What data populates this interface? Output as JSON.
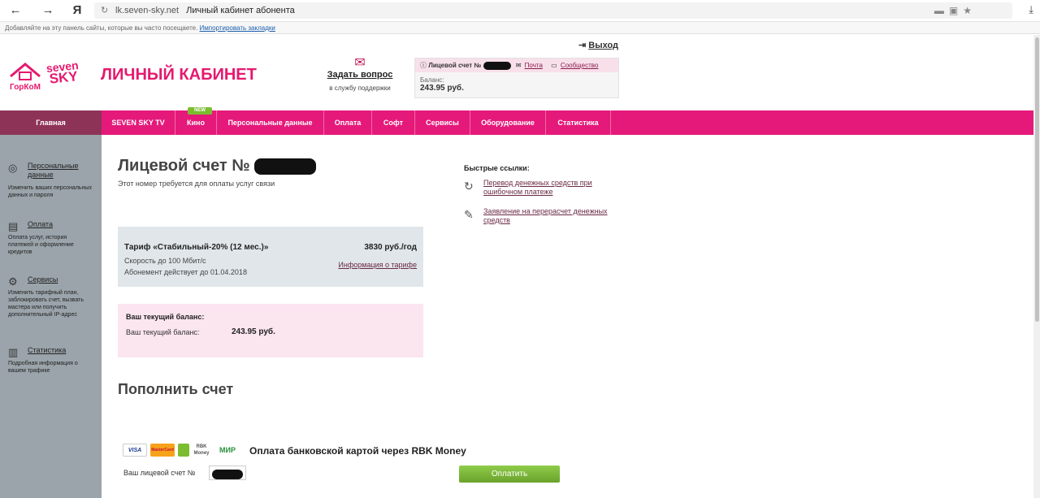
{
  "browser": {
    "nav_back": "←",
    "nav_forward": "→",
    "yandex_icon": "Я",
    "domain": "lk.seven-sky.net",
    "page_title": "Личный кабинет абонента",
    "bookmarks_prompt": "Добавляйте на эту панель сайты, которые вы часто посещаете.",
    "bookmarks_link": "Импортировать закладки"
  },
  "header": {
    "logo_gorkom": "ГорКоМ",
    "logo_seven": "seven",
    "logo_sky": "SKY",
    "title": "ЛИЧНЫЙ КАБИНЕТ",
    "ask_title": "Задать вопрос",
    "ask_sub": "в службу поддержки",
    "logout": "Выход",
    "account_label": "Лицевой счет №",
    "mail_link": "Почта",
    "community_link": "Сообщество",
    "balance_label": "Баланс:",
    "balance_value": "243.95 руб."
  },
  "nav": {
    "home": "Главная",
    "items": [
      "SEVEN SKY TV",
      "Кино",
      "Персональные данные",
      "Оплата",
      "Софт",
      "Сервисы",
      "Оборудование",
      "Статистика"
    ],
    "new_badge": "NEW"
  },
  "sidebar": {
    "items": [
      {
        "label": "Персональные данные",
        "desc": "Изменить ваших персональных данных и пароля",
        "icon": "person-icon"
      },
      {
        "label": "Оплата",
        "desc": "Оплата услуг, история платежей и оформление кредитов",
        "icon": "wallet-icon"
      },
      {
        "label": "Сервисы",
        "desc": "Изменить тарифный план, заблокировать счет, вызвать мастера или получить дополнительный IP-адрес",
        "icon": "gear-icon"
      },
      {
        "label": "Статистика",
        "desc": "Подробная информация о вашем трафике",
        "icon": "bar-chart-icon"
      }
    ]
  },
  "main": {
    "account_title": "Лицевой счет №",
    "account_sub": "Этот номер требуется для оплаты услуг связи",
    "tariff": {
      "name": "Тариф «Стабильный-20% (12 мес.)»",
      "price": "3830 руб./год",
      "speed": "Скорость до 100 Мбит/с",
      "info_link": "Информация о тарифе",
      "valid": "Абонемент действует до 01.04.2018"
    },
    "balance": {
      "heading": "Ваш текущий баланс:",
      "label": "Ваш текущий баланс:",
      "value": "243.95 руб."
    },
    "topup_title": "Пополнить счет",
    "payment": {
      "logos": [
        "VISA",
        "MasterCard",
        "RBK Money",
        "МИР"
      ],
      "title": "Оплата банковской картой через RBK Money",
      "account_label": "Ваш лицевой счет №",
      "pay_button": "Оплатить"
    }
  },
  "quick_links": {
    "title": "Быстрые ссылки:",
    "items": [
      {
        "label": "Перевод денежных средств при ошибочном платеже",
        "icon": "refresh-icon"
      },
      {
        "label": "Заявление на перерасчет денежных средств",
        "icon": "edit-icon"
      }
    ]
  },
  "colors": {
    "brand_pink": "#e5197a",
    "nav_home": "#8e3358",
    "sidebar": "#9aa4aa",
    "pay_green": "#7bbd2f"
  }
}
